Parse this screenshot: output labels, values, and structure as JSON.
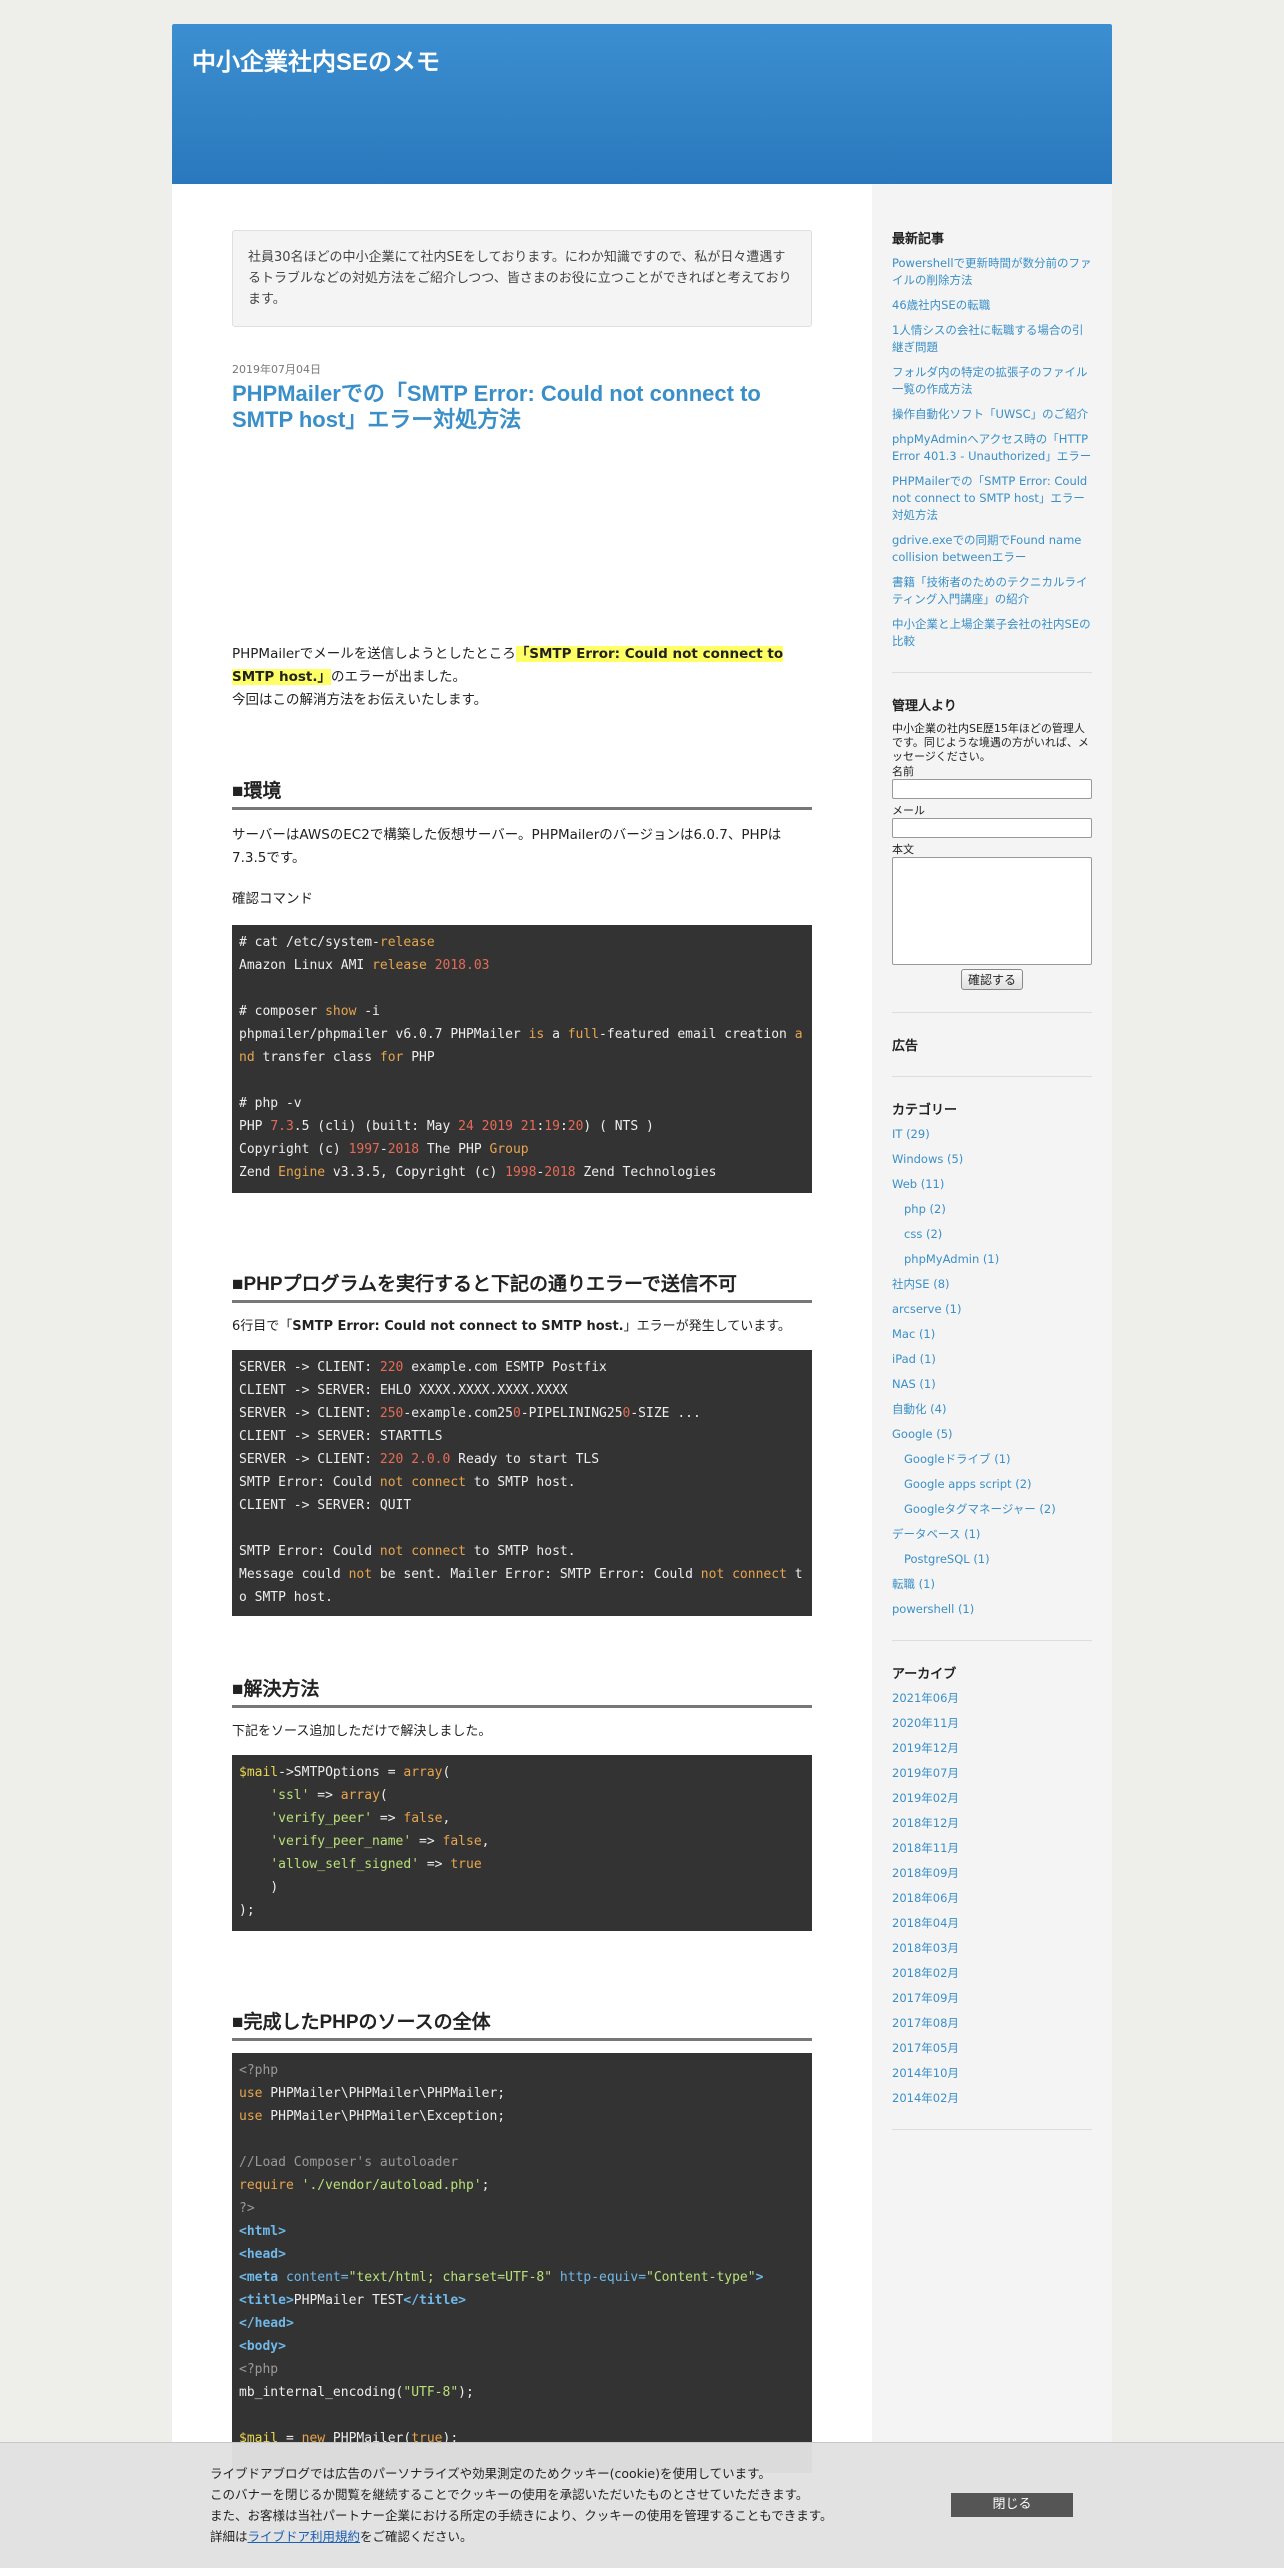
{
  "site": {
    "title": "中小企業社内SEのメモ"
  },
  "intro": "社員30名ほどの中小企業にて社内SEをしております。にわか知識ですので、私が日々遭遇するトラブルなどの対処方法をご紹介しつつ、皆さまのお役に立つことができればと考えております。",
  "post": {
    "date": "2019年07月04日",
    "title": "PHPMailerでの「SMTP Error: Could not connect to SMTP host」エラー対処方法",
    "lead_before": "PHPMailerでメールを送信しようとしたところ",
    "lead_highlight": "「SMTP Error: Could not connect to SMTP host.」",
    "lead_after": "のエラーが出ました。",
    "lead_line2": "今回はこの解消方法をお伝えいたします。",
    "h_env": "■環境",
    "env_text": "サーバーはAWSのEC2で構築した仮想サーバー。PHPMailerのバージョンは6.0.7、PHPは7.3.5です。",
    "confirm_cmd": "確認コマンド",
    "h_error": "■PHPプログラムを実行すると下記の通りエラーで送信不可",
    "error_text_before": "6行目で「",
    "error_text_bold": "SMTP Error: Could not connect to SMTP host.",
    "error_text_after": "」エラーが発生しています。",
    "h_solution": "■解決方法",
    "solution_text": "下記をソース追加しただけで解決しました。",
    "h_full": "■完成したPHPのソースの全体"
  },
  "sidebar": {
    "recent_heading": "最新記事",
    "recent": [
      "Powershellで更新時間が数分前のファイルの削除方法",
      "46歳社内SEの転職",
      "1人情シスの会社に転職する場合の引継ぎ問題",
      "フォルダ内の特定の拡張子のファイル一覧の作成方法",
      "操作自動化ソフト「UWSC」のご紹介",
      "phpMyAdminへアクセス時の「HTTP Error 401.3 - Unauthorized」エラー",
      "PHPMailerでの「SMTP Error: Could not connect to SMTP host」エラー対処方法",
      "gdrive.exeでの同期でFound name collision betweenエラー",
      "書籍「技術者のためのテクニカルライティング入門講座」の紹介",
      "中小企業と上場企業子会社の社内SEの比較"
    ],
    "admin_heading": "管理人より",
    "admin_text": "中小企業の社内SE歴15年ほどの管理人です。同じような境遇の方がいれば、メッセージください。",
    "form_name": "名前",
    "form_mail": "メール",
    "form_body": "本文",
    "form_submit": "確認する",
    "ad_heading": "広告",
    "category_heading": "カテゴリー",
    "categories": [
      {
        "label": "IT (29)",
        "sub": false
      },
      {
        "label": "Windows (5)",
        "sub": false
      },
      {
        "label": "Web (11)",
        "sub": false
      },
      {
        "label": "php (2)",
        "sub": true
      },
      {
        "label": "css (2)",
        "sub": true
      },
      {
        "label": "phpMyAdmin (1)",
        "sub": true
      },
      {
        "label": "社内SE (8)",
        "sub": false
      },
      {
        "label": "arcserve (1)",
        "sub": false
      },
      {
        "label": "Mac (1)",
        "sub": false
      },
      {
        "label": "iPad (1)",
        "sub": false
      },
      {
        "label": "NAS (1)",
        "sub": false
      },
      {
        "label": "自動化 (4)",
        "sub": false
      },
      {
        "label": "Google (5)",
        "sub": false
      },
      {
        "label": "Googleドライブ (1)",
        "sub": true
      },
      {
        "label": "Google apps script (2)",
        "sub": true
      },
      {
        "label": "Googleタグマネージャー (2)",
        "sub": true
      },
      {
        "label": "データベース (1)",
        "sub": false
      },
      {
        "label": "PostgreSQL (1)",
        "sub": true
      },
      {
        "label": "転職 (1)",
        "sub": false
      },
      {
        "label": "powershell (1)",
        "sub": false
      }
    ],
    "archive_heading": "アーカイブ",
    "archives": [
      "2021年06月",
      "2020年11月",
      "2019年12月",
      "2019年07月",
      "2019年02月",
      "2018年12月",
      "2018年11月",
      "2018年09月",
      "2018年06月",
      "2018年04月",
      "2018年03月",
      "2018年02月",
      "2017年09月",
      "2017年08月",
      "2017年05月",
      "2014年10月",
      "2014年02月"
    ]
  },
  "banner": {
    "line1": "ライブドアブログでは広告のパーソナライズや効果測定のためクッキー(cookie)を使用しています。",
    "line2": "このバナーを閉じるか閲覧を継続することでクッキーの使用を承認いただいたものとさせていただきます。",
    "line3": "また、お客様は当社パートナー企業における所定の手続きにより、クッキーの使用を管理することもできます。",
    "line4_before": "詳細は",
    "line4_link": "ライブドア利用規約",
    "line4_after": "をご確認ください。",
    "close_label": "閉じる"
  },
  "colors": {
    "header": "#2a78bd",
    "link": "#3a8fc8",
    "highlight": "#ffff66",
    "code_bg": "#333333"
  }
}
